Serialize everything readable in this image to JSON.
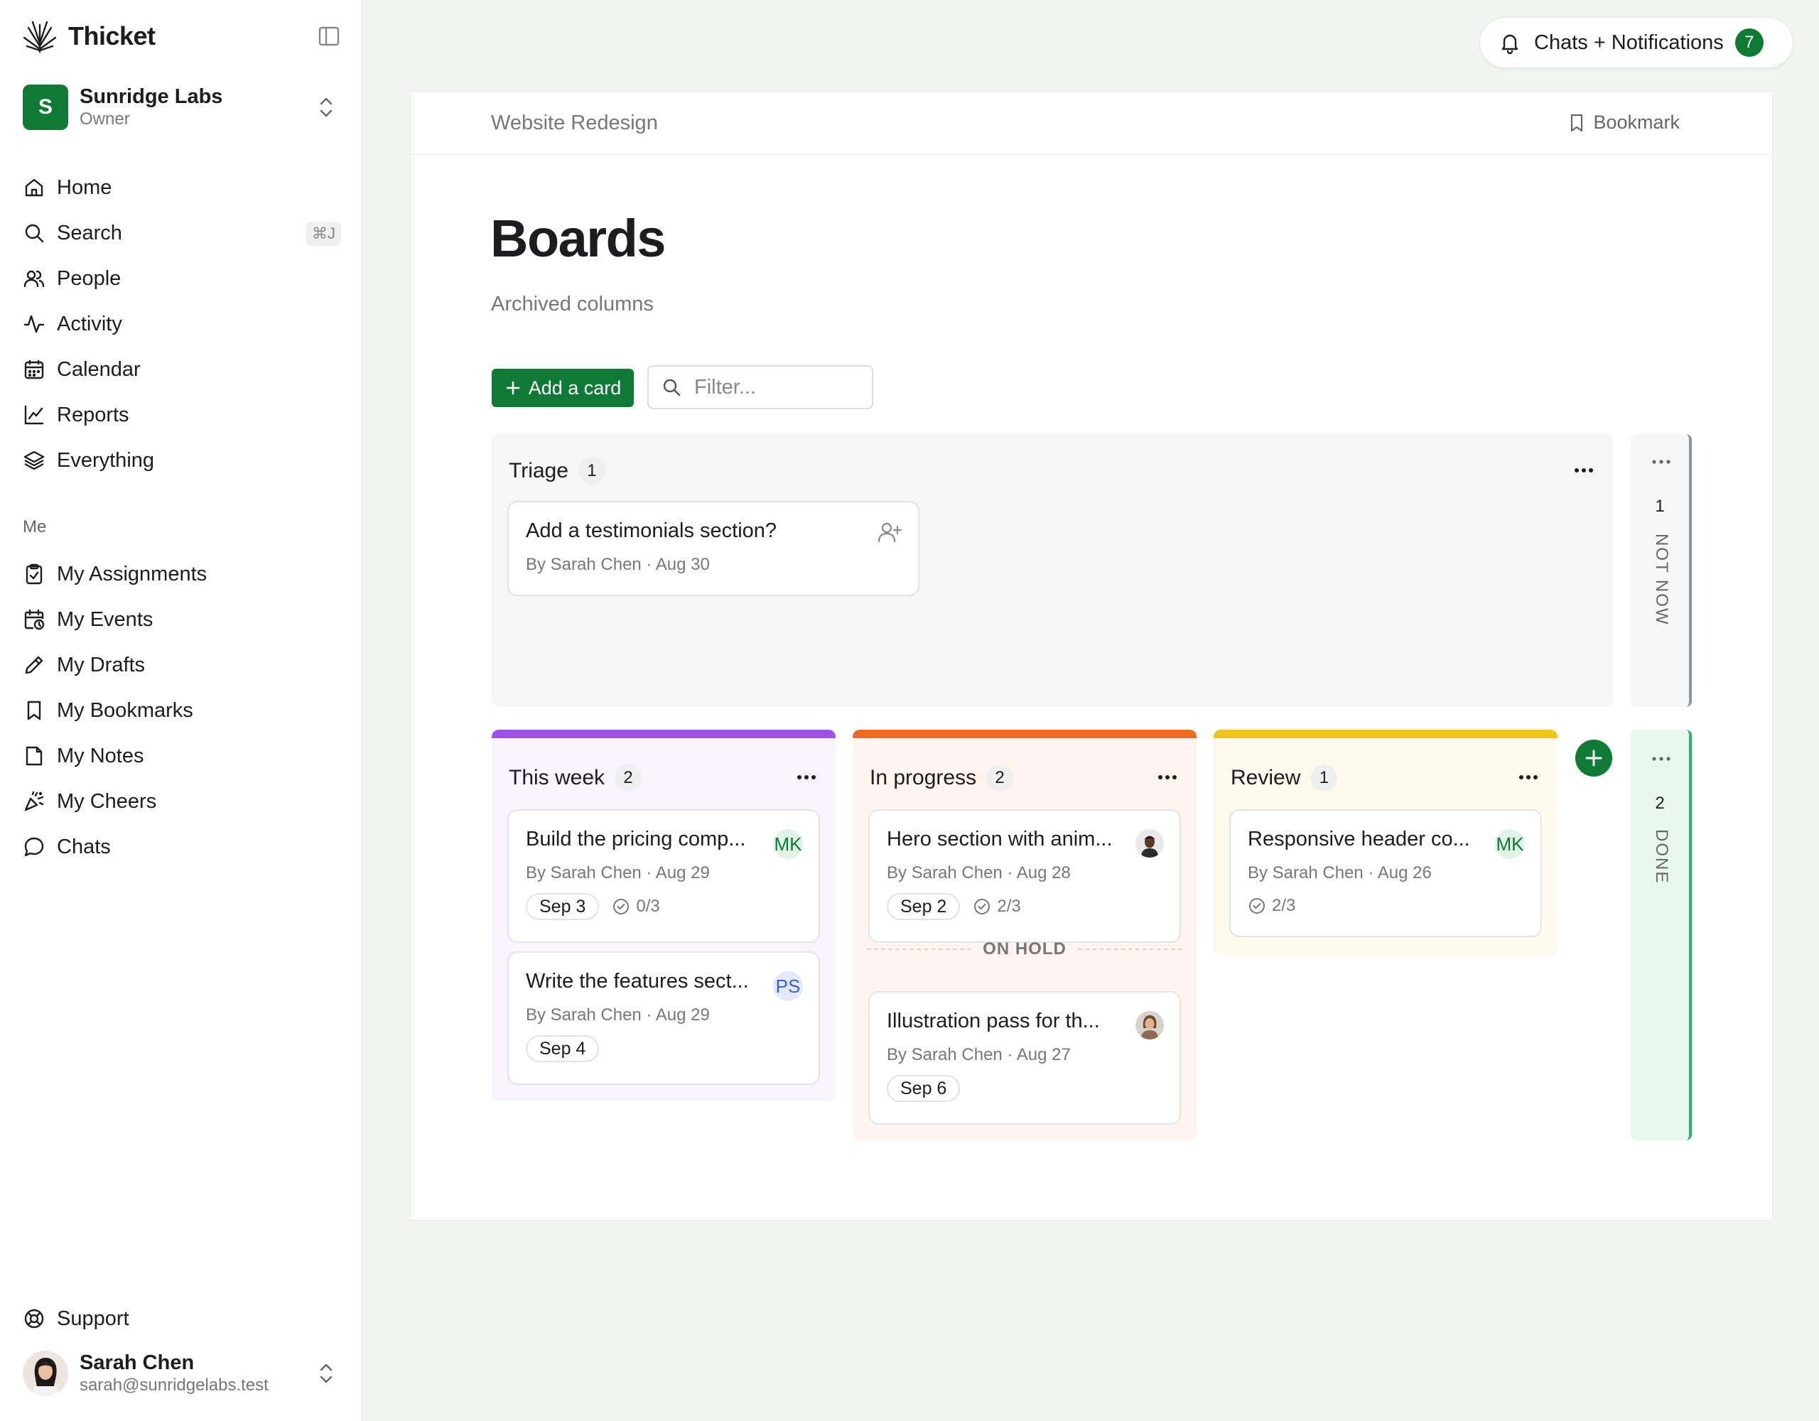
{
  "app": {
    "name": "Thicket"
  },
  "org": {
    "initial": "S",
    "name": "Sunridge Labs",
    "role": "Owner"
  },
  "nav": [
    {
      "label": "Home",
      "icon": "home-icon"
    },
    {
      "label": "Search",
      "icon": "search-icon",
      "shortcut": "⌘J"
    },
    {
      "label": "People",
      "icon": "people-icon"
    },
    {
      "label": "Activity",
      "icon": "activity-icon"
    },
    {
      "label": "Calendar",
      "icon": "calendar-icon"
    },
    {
      "label": "Reports",
      "icon": "reports-icon"
    },
    {
      "label": "Everything",
      "icon": "layers-icon"
    }
  ],
  "me": {
    "section_label": "Me",
    "items": [
      {
        "label": "My Assignments",
        "icon": "clipboard-check-icon"
      },
      {
        "label": "My Events",
        "icon": "calendar-clock-icon"
      },
      {
        "label": "My Drafts",
        "icon": "pencil-icon"
      },
      {
        "label": "My Bookmarks",
        "icon": "bookmark-icon"
      },
      {
        "label": "My Notes",
        "icon": "note-icon"
      },
      {
        "label": "My Cheers",
        "icon": "party-icon"
      },
      {
        "label": "Chats",
        "icon": "chat-icon"
      }
    ]
  },
  "support": {
    "label": "Support",
    "icon": "lifebuoy-icon"
  },
  "user": {
    "name": "Sarah Chen",
    "email": "sarah@sunridgelabs.test"
  },
  "notifications": {
    "label": "Chats + Notifications",
    "count": "7"
  },
  "page": {
    "breadcrumb": "Website Redesign",
    "bookmark_label": "Bookmark",
    "title": "Boards",
    "subtitle": "Archived columns",
    "add_card_label": "Add a card",
    "filter_placeholder": "Filter..."
  },
  "colors": {
    "brand": "#0f7a35",
    "this_week": "#a24ee8",
    "in_progress": "#f06b1c",
    "review": "#f2c417",
    "done": "#27b35a",
    "not_now": "#8a94a6"
  },
  "columns": {
    "triage": {
      "title": "Triage",
      "count": "1",
      "cards": [
        {
          "title": "Add a testimonials section?",
          "meta": "By Sarah Chen · Aug 30",
          "icon": "add-person-icon"
        }
      ]
    },
    "this_week": {
      "title": "This week",
      "count": "2",
      "cards": [
        {
          "title": "Build the pricing comp...",
          "meta": "By Sarah Chen · Aug 29",
          "date": "Sep 3",
          "checks": "0/3",
          "assignee": "MK"
        },
        {
          "title": "Write the features sect...",
          "meta": "By Sarah Chen · Aug 29",
          "date": "Sep 4",
          "assignee": "PS"
        }
      ]
    },
    "in_progress": {
      "title": "In progress",
      "count": "2",
      "cards": [
        {
          "title": "Hero section with anim...",
          "meta": "By Sarah Chen · Aug 28",
          "date": "Sep 2",
          "checks": "2/3"
        },
        {
          "title": "Illustration pass for th...",
          "meta": "By Sarah Chen · Aug 27",
          "date": "Sep 6"
        }
      ],
      "divider": "ON HOLD"
    },
    "review": {
      "title": "Review",
      "count": "1",
      "cards": [
        {
          "title": "Responsive header co...",
          "meta": "By Sarah Chen · Aug 26",
          "checks": "2/3",
          "assignee": "MK"
        }
      ]
    },
    "not_now": {
      "label": "NOT NOW",
      "count": "1"
    },
    "done": {
      "label": "DONE",
      "count": "2"
    }
  }
}
